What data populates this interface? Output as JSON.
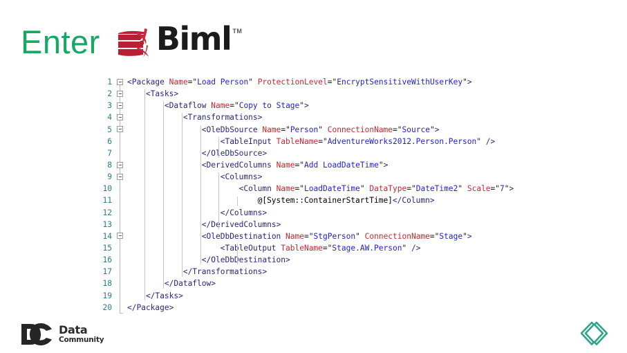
{
  "slide": {
    "title_prefix": "Enter",
    "brand_name": "Biml",
    "brand_trademark": "TM",
    "brand_mark_icon": "biml-ribbon-icon",
    "accent_green": "#17a863",
    "brand_red": "#b81f35",
    "teal": "#2ba58a",
    "background": "#ffffff"
  },
  "code": {
    "language": "xml",
    "indent_size": 4,
    "colors": {
      "line_number": "#2b7b8c",
      "tag": "#26267f",
      "attribute": "#c1292e",
      "value": "#2222cc",
      "text": "#000000"
    },
    "lines": [
      {
        "n": "1",
        "fold": "open",
        "indent": 0,
        "raw": "<Package Name=\"Load Person\" ProtectionLevel=\"EncryptSensitiveWithUserKey\">"
      },
      {
        "n": "2",
        "fold": "open",
        "indent": 1,
        "raw": "<Tasks>"
      },
      {
        "n": "3",
        "fold": "open",
        "indent": 2,
        "raw": "<Dataflow Name=\"Copy to Stage\">"
      },
      {
        "n": "4",
        "fold": "open",
        "indent": 3,
        "raw": "<Transformations>"
      },
      {
        "n": "5",
        "fold": "open",
        "indent": 4,
        "raw": "<OleDbSource Name=\"Person\" ConnectionName=\"Source\">"
      },
      {
        "n": "6",
        "fold": "none",
        "indent": 5,
        "raw": "<TableInput TableName=\"AdventureWorks2012.Person.Person\" />"
      },
      {
        "n": "7",
        "fold": "none",
        "indent": 4,
        "raw": "</OleDbSource>"
      },
      {
        "n": "8",
        "fold": "open",
        "indent": 4,
        "raw": "<DerivedColumns Name=\"Add LoadDateTime\">"
      },
      {
        "n": "9",
        "fold": "open",
        "indent": 5,
        "raw": "<Columns>"
      },
      {
        "n": "10",
        "fold": "none",
        "indent": 6,
        "raw": "<Column Name=\"LoadDateTime\" DataType=\"DateTime2\" Scale=\"7\">"
      },
      {
        "n": "11",
        "fold": "none",
        "indent": 7,
        "raw": "@[System::ContainerStartTime]</Column>"
      },
      {
        "n": "12",
        "fold": "none",
        "indent": 5,
        "raw": "</Columns>"
      },
      {
        "n": "13",
        "fold": "none",
        "indent": 4,
        "raw": "</DerivedColumns>"
      },
      {
        "n": "14",
        "fold": "open",
        "indent": 4,
        "raw": "<OleDbDestination Name=\"StgPerson\" ConnectionName=\"Stage\">"
      },
      {
        "n": "15",
        "fold": "none",
        "indent": 5,
        "raw": "<TableOutput TableName=\"Stage.AW.Person\" />"
      },
      {
        "n": "16",
        "fold": "none",
        "indent": 4,
        "raw": "</OleDbDestination>"
      },
      {
        "n": "17",
        "fold": "none",
        "indent": 3,
        "raw": "</Transformations>"
      },
      {
        "n": "18",
        "fold": "none",
        "indent": 2,
        "raw": "</Dataflow>"
      },
      {
        "n": "19",
        "fold": "none",
        "indent": 1,
        "raw": "</Tasks>"
      },
      {
        "n": "20",
        "fold": "none",
        "indent": 0,
        "raw": "</Package>"
      }
    ]
  },
  "footer": {
    "logo_mark_icon": "dc-monogram-icon",
    "logo_line1": "Data",
    "logo_line2": "Community",
    "corner_icon": "code-brackets-icon"
  }
}
